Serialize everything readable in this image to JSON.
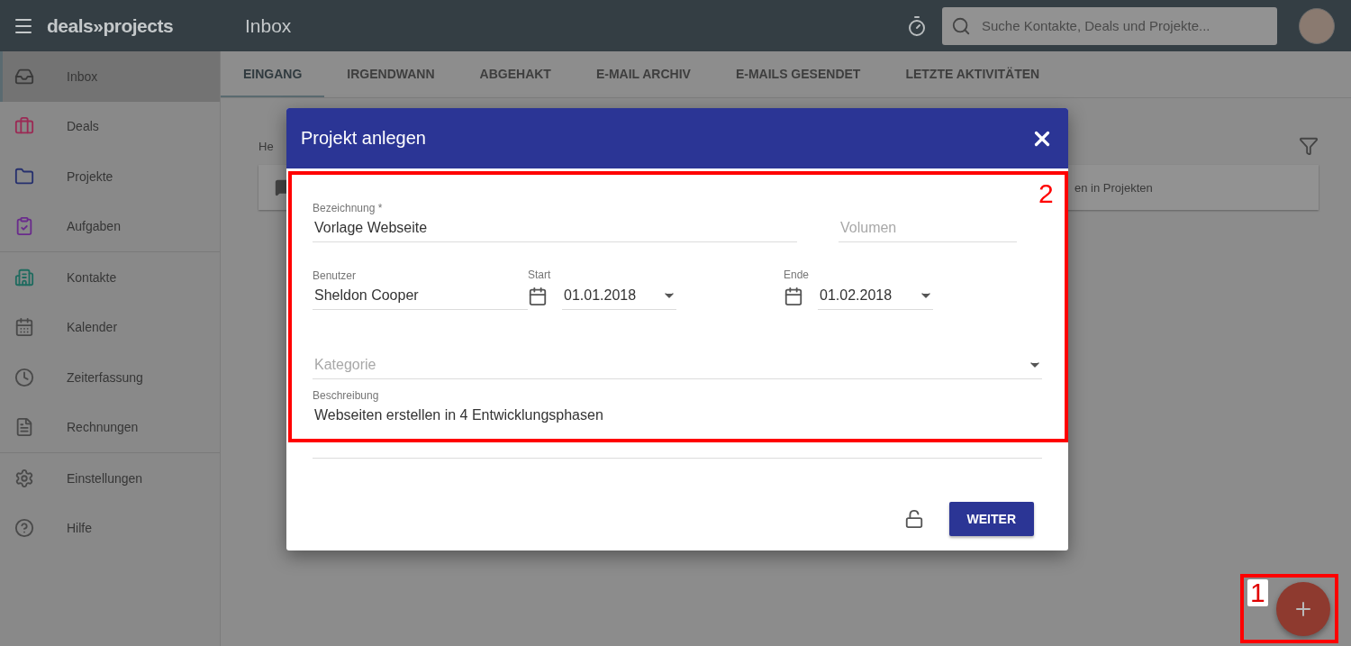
{
  "topbar": {
    "logo": "deals»projects",
    "title": "Inbox",
    "search": {
      "placeholder": "Suche Kontakte, Deals und Projekte..."
    }
  },
  "sidebar": {
    "groups": [
      [
        {
          "label": "Inbox",
          "selected": true,
          "color": "#3a3a3a"
        },
        {
          "label": "Deals",
          "selected": false,
          "color": "#9b2a55"
        },
        {
          "label": "Projekte",
          "selected": false,
          "color": "#26306e"
        },
        {
          "label": "Aufgaben",
          "selected": false,
          "color": "#6a2b8c"
        }
      ],
      [
        {
          "label": "Kontakte",
          "selected": false,
          "color": "#1f6b5f"
        },
        {
          "label": "Kalender",
          "selected": false,
          "color": "#4a4a4a"
        },
        {
          "label": "Zeiterfassung",
          "selected": false,
          "color": "#4a4a4a"
        },
        {
          "label": "Rechnungen",
          "selected": false,
          "color": "#4a4a4a"
        }
      ],
      [
        {
          "label": "Einstellungen",
          "selected": false,
          "color": "#4a4a4a"
        },
        {
          "label": "Hilfe",
          "selected": false,
          "color": "#4a4a4a"
        }
      ]
    ]
  },
  "tabs": [
    {
      "label": "EINGANG",
      "selected": true
    },
    {
      "label": "IRGENDWANN",
      "selected": false
    },
    {
      "label": "ABGEHAKT",
      "selected": false
    },
    {
      "label": "E-MAIL ARCHIV",
      "selected": false
    },
    {
      "label": "E-MAILS GESENDET",
      "selected": false
    },
    {
      "label": "LETZTE AKTIVITÄTEN",
      "selected": false
    }
  ],
  "content": {
    "heading": "He",
    "card_text": "en in Projekten"
  },
  "dialog": {
    "title": "Projekt anlegen",
    "fields": [
      {
        "kind": "text",
        "label": "Bezeichnung *",
        "value": "Vorlage Webseite"
      },
      {
        "kind": "text",
        "placeholder": "Volumen"
      },
      {
        "kind": "text",
        "label": "Benutzer",
        "value": "Sheldon Cooper"
      },
      {
        "kind": "date",
        "label": "Start",
        "value": "01.01.2018"
      },
      {
        "kind": "date",
        "label": "Ende",
        "value": "01.02.2018"
      },
      {
        "kind": "select",
        "placeholder": "Kategorie"
      },
      {
        "kind": "textarea",
        "label": "Beschreibung",
        "value": "Webseiten erstellen in 4 Entwicklungsphasen"
      }
    ],
    "button": "WEITER"
  },
  "annotations": [
    {
      "label": "2"
    },
    {
      "label": "1"
    }
  ]
}
